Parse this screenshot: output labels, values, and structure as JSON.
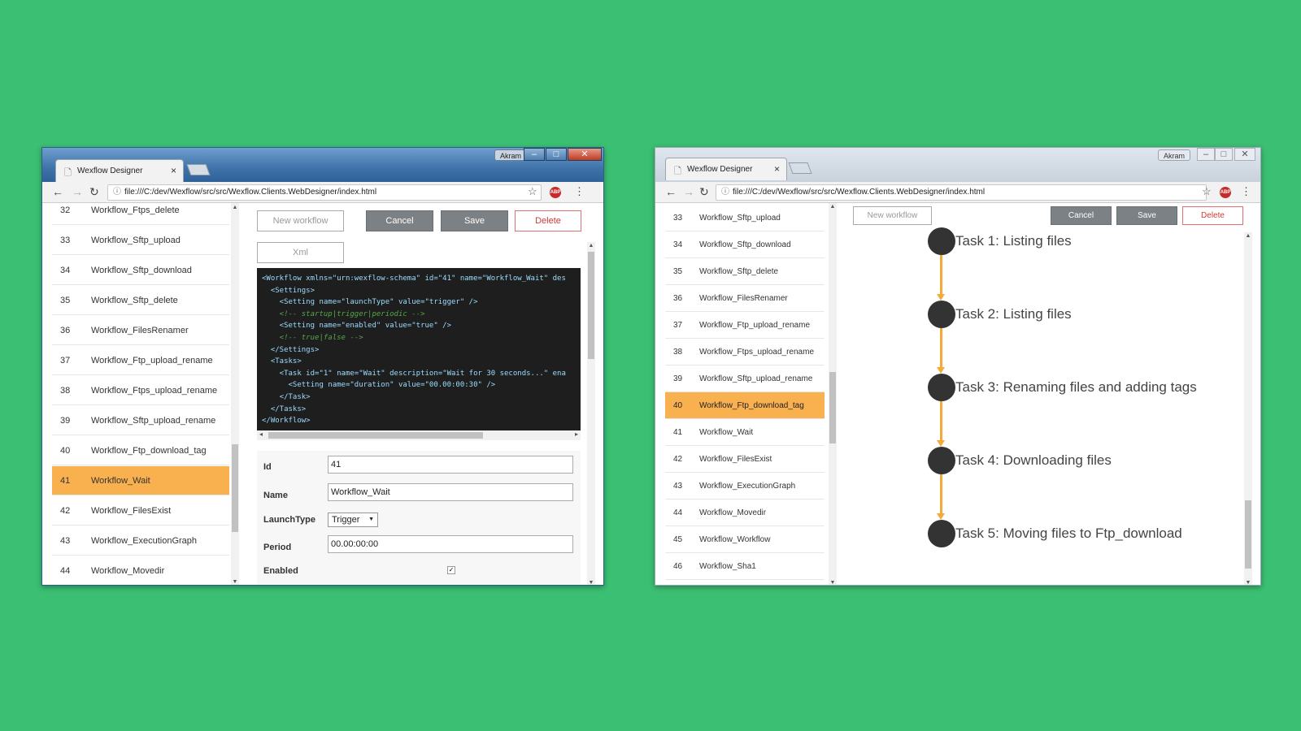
{
  "tab_title": "Wexflow Designer",
  "user_badge": "Akram",
  "url": "file:///C:/dev/Wexflow/src/src/Wexflow.Clients.WebDesigner/index.html",
  "buttons": {
    "new_workflow": "New workflow",
    "cancel": "Cancel",
    "save": "Save",
    "delete": "Delete",
    "xml": "Xml"
  },
  "left": {
    "workflows": [
      {
        "id": "32",
        "name": "Workflow_Ftps_delete"
      },
      {
        "id": "33",
        "name": "Workflow_Sftp_upload"
      },
      {
        "id": "34",
        "name": "Workflow_Sftp_download"
      },
      {
        "id": "35",
        "name": "Workflow_Sftp_delete"
      },
      {
        "id": "36",
        "name": "Workflow_FilesRenamer"
      },
      {
        "id": "37",
        "name": "Workflow_Ftp_upload_rename"
      },
      {
        "id": "38",
        "name": "Workflow_Ftps_upload_rename"
      },
      {
        "id": "39",
        "name": "Workflow_Sftp_upload_rename"
      },
      {
        "id": "40",
        "name": "Workflow_Ftp_download_tag"
      },
      {
        "id": "41",
        "name": "Workflow_Wait"
      },
      {
        "id": "42",
        "name": "Workflow_FilesExist"
      },
      {
        "id": "43",
        "name": "Workflow_ExecutionGraph"
      },
      {
        "id": "44",
        "name": "Workflow_Movedir"
      }
    ],
    "selected_id": "41",
    "xml_lines": [
      "<Workflow xmlns=\"urn:wexflow-schema\" id=\"41\" name=\"Workflow_Wait\" des",
      "  <Settings>",
      "    <Setting name=\"launchType\" value=\"trigger\" />",
      "    <!-- startup|trigger|periodic -->",
      "    <Setting name=\"enabled\" value=\"true\" />",
      "    <!-- true|false -->",
      "  </Settings>",
      "  <Tasks>",
      "    <Task id=\"1\" name=\"Wait\" description=\"Wait for 30 seconds...\" ena",
      "      <Setting name=\"duration\" value=\"00.00:00:30\" />",
      "    </Task>",
      "  </Tasks>",
      "</Workflow>"
    ],
    "form": {
      "id_label": "Id",
      "id_value": "41",
      "name_label": "Name",
      "name_value": "Workflow_Wait",
      "launch_type_label": "LaunchType",
      "launch_type_value": "Trigger",
      "period_label": "Period",
      "period_value": "00.00:00:00",
      "enabled_label": "Enabled",
      "enabled_checked": true
    }
  },
  "right": {
    "workflows": [
      {
        "id": "33",
        "name": "Workflow_Sftp_upload"
      },
      {
        "id": "34",
        "name": "Workflow_Sftp_download"
      },
      {
        "id": "35",
        "name": "Workflow_Sftp_delete"
      },
      {
        "id": "36",
        "name": "Workflow_FilesRenamer"
      },
      {
        "id": "37",
        "name": "Workflow_Ftp_upload_rename"
      },
      {
        "id": "38",
        "name": "Workflow_Ftps_upload_rename"
      },
      {
        "id": "39",
        "name": "Workflow_Sftp_upload_rename"
      },
      {
        "id": "40",
        "name": "Workflow_Ftp_download_tag"
      },
      {
        "id": "41",
        "name": "Workflow_Wait"
      },
      {
        "id": "42",
        "name": "Workflow_FilesExist"
      },
      {
        "id": "43",
        "name": "Workflow_ExecutionGraph"
      },
      {
        "id": "44",
        "name": "Workflow_Movedir"
      },
      {
        "id": "45",
        "name": "Workflow_Workflow"
      },
      {
        "id": "46",
        "name": "Workflow_Sha1"
      }
    ],
    "selected_id": "40",
    "graph_tasks": [
      "Task 1: Listing files",
      "Task 2: Listing files",
      "Task 3: Renaming files and adding tags",
      "Task 4: Downloading files",
      "Task 5: Moving files to Ftp_download"
    ]
  },
  "colors": {
    "background": "#3bbf72",
    "selected_row": "#f9b04f",
    "graph_edge": "#f5a93b",
    "graph_node": "#333333"
  }
}
